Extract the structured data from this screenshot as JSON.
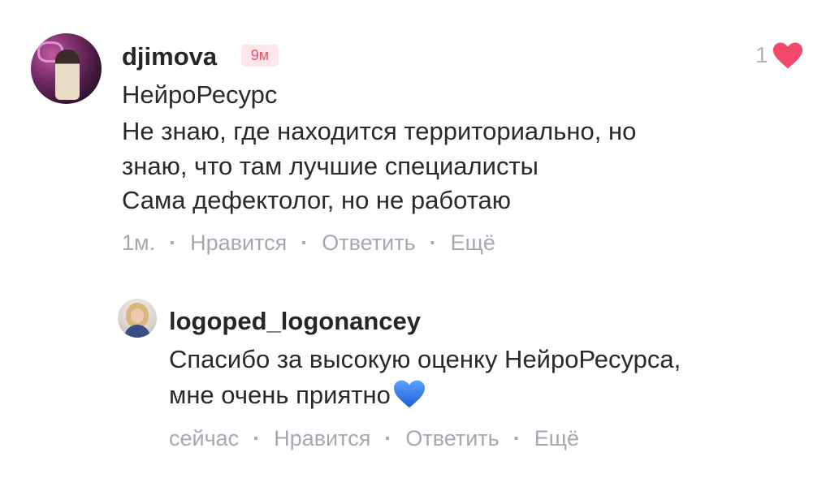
{
  "comment": {
    "username": "djimova",
    "badge": "9м",
    "likes": "1",
    "lines": [
      "НейроРесурс",
      "Не знаю, где находится территориально, но",
      "знаю, что там лучшие специалисты",
      "Сама дефектолог, но не работаю"
    ],
    "time": "1м.",
    "like_label": "Нравится",
    "reply_label": "Ответить",
    "more_label": "Ещё",
    "separator": "·",
    "heart_color": "#f2496a"
  },
  "reply": {
    "username": "logoped_logonancey",
    "lines": [
      "Спасибо за высокую оценку НейроРесурса,",
      "мне очень приятно"
    ],
    "emoji": "blue-heart",
    "time": "сейчас",
    "like_label": "Нравится",
    "reply_label": "Ответить",
    "more_label": "Ещё",
    "separator": "·",
    "emoji_color": "#2f7ef0"
  }
}
